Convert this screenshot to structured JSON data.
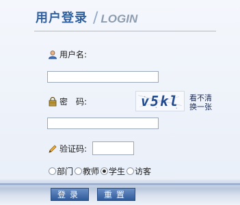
{
  "header": {
    "title_cn": "用户登录",
    "separator": "/",
    "title_en": "LOGIN"
  },
  "form": {
    "username_label": "用户名:",
    "username_value": "",
    "password_label": "密　码:",
    "password_value": "",
    "captcha_text": "v5kl",
    "captcha_refresh_line1": "看不清",
    "captcha_refresh_line2": "换一张",
    "verify_label": "验证码:",
    "verify_value": ""
  },
  "roles": [
    {
      "label": "部门",
      "selected": false
    },
    {
      "label": "教师",
      "selected": false
    },
    {
      "label": "学生",
      "selected": true
    },
    {
      "label": "访客",
      "selected": false
    }
  ],
  "buttons": {
    "login": "登录",
    "reset": "重置"
  },
  "icons": {
    "user": "user-icon",
    "lock": "lock-icon",
    "pencil": "pencil-icon"
  },
  "colors": {
    "title": "#2f5f9e",
    "button": "#2f5a9a",
    "background": "#eef3fb"
  }
}
